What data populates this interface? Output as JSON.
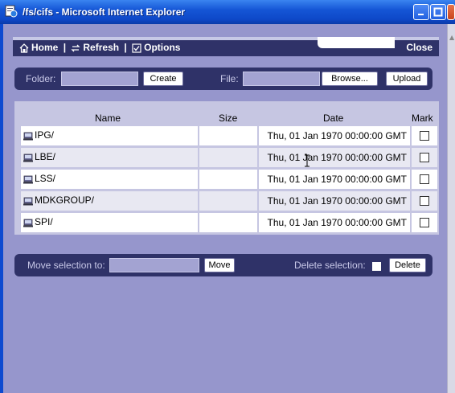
{
  "window": {
    "title": "/fs/cifs - Microsoft Internet Explorer"
  },
  "toolbar": {
    "home_label": "Home",
    "refresh_label": "Refresh",
    "options_label": "Options",
    "separator": "|",
    "close_label": "Close"
  },
  "folderbar": {
    "folder_label": "Folder:",
    "create_label": "Create",
    "file_label": "File:",
    "browse_label": "Browse...",
    "upload_label": "Upload"
  },
  "table": {
    "headers": {
      "name": "Name",
      "size": "Size",
      "date": "Date",
      "mark": "Mark"
    },
    "rows": [
      {
        "name": "IPG/",
        "size": "",
        "date": "Thu, 01 Jan 1970 00:00:00 GMT",
        "marked": false
      },
      {
        "name": "LBE/",
        "size": "",
        "date": "Thu, 01 Jan 1970 00:00:00 GMT",
        "marked": false
      },
      {
        "name": "LSS/",
        "size": "",
        "date": "Thu, 01 Jan 1970 00:00:00 GMT",
        "marked": false
      },
      {
        "name": "MDKGROUP/",
        "size": "",
        "date": "Thu, 01 Jan 1970 00:00:00 GMT",
        "marked": false
      },
      {
        "name": "SPI/",
        "size": "",
        "date": "Thu, 01 Jan 1970 00:00:00 GMT",
        "marked": false
      }
    ]
  },
  "bottombar": {
    "move_label": "Move selection to:",
    "move_button": "Move",
    "delete_label": "Delete selection:",
    "delete_button": "Delete"
  },
  "colors": {
    "background": "#9696cc",
    "bar": "#2f3268",
    "table_bg": "#c6c6e2"
  }
}
